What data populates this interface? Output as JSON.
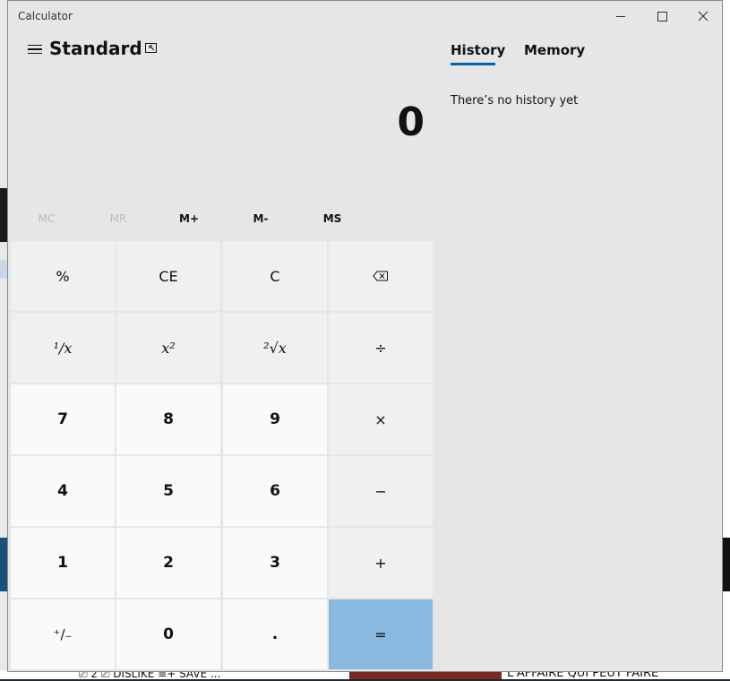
{
  "window": {
    "title": "Calculator",
    "controls": {
      "minimize": "minimize",
      "maximize": "maximize",
      "close": "close"
    }
  },
  "header": {
    "mode_title": "Standard",
    "icons": {
      "menu": "hamburger-menu-icon",
      "keep_on_top": "keep-on-top-icon"
    }
  },
  "display": {
    "value": "0"
  },
  "memory_buttons": [
    {
      "label": "MC",
      "enabled": false
    },
    {
      "label": "MR",
      "enabled": false
    },
    {
      "label": "M+",
      "enabled": true
    },
    {
      "label": "M-",
      "enabled": true
    },
    {
      "label": "MS",
      "enabled": true
    }
  ],
  "keypad": {
    "percent": "%",
    "clear_entry": "CE",
    "clear": "C",
    "backspace": "backspace",
    "reciprocal": "¹/x",
    "square": "x²",
    "sqrt": "²√x",
    "divide": "÷",
    "seven": "7",
    "eight": "8",
    "nine": "9",
    "multiply": "×",
    "four": "4",
    "five": "5",
    "six": "6",
    "minus": "−",
    "one": "1",
    "two": "2",
    "three": "3",
    "plus": "+",
    "negate": "⁺/₋",
    "zero": "0",
    "decimal": ".",
    "equals": "="
  },
  "side_panel": {
    "tabs": [
      "History",
      "Memory"
    ],
    "active_tab": "History",
    "empty_message": "There’s no history yet"
  },
  "background": {
    "bottom_actions": "⎚ 2   ⎚ DISLIKE   ≡+ SAVE   ...",
    "bottom_title": "L'AFFAIRE QUI PEUT FAIRE"
  },
  "colors": {
    "window_bg": "#e6e6e6",
    "equals_key": "#8ab9e0",
    "accent": "#0063b1"
  }
}
